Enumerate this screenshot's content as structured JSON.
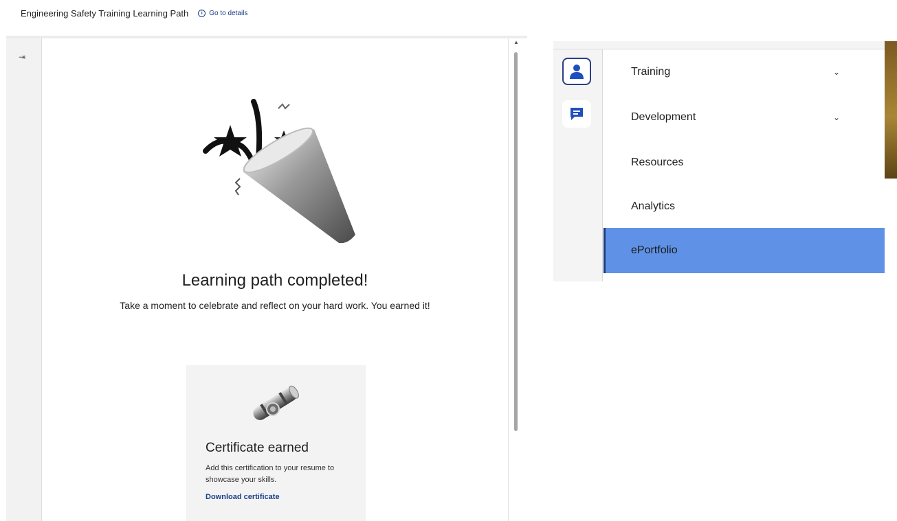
{
  "header": {
    "title": "Engineering Safety Training Learning Path",
    "details_link": "Go to details"
  },
  "left_rail": {
    "collapse_icon": "collapse-right-icon"
  },
  "completion": {
    "title": "Learning path completed!",
    "subtitle": "Take a moment to celebrate and reflect on your hard work. You earned it!",
    "illustration": "party-popper-icon"
  },
  "certificate": {
    "title": "Certificate earned",
    "description": "Add this certification to your resume to showcase your skills.",
    "link": "Download certificate",
    "illustration": "certificate-scroll-icon"
  },
  "menu": {
    "rail_icons": [
      "profile-icon",
      "chat-icon"
    ],
    "items": [
      {
        "label": "Training",
        "expandable": true
      },
      {
        "label": "Development",
        "expandable": true
      },
      {
        "label": "Resources",
        "expandable": false
      },
      {
        "label": "Analytics",
        "expandable": false
      },
      {
        "label": "ePortfolio",
        "expandable": false,
        "active": true
      }
    ]
  },
  "colors": {
    "active_item": "#5f92e6",
    "active_bar": "#1d3b7a",
    "link": "#1c3f8a"
  }
}
